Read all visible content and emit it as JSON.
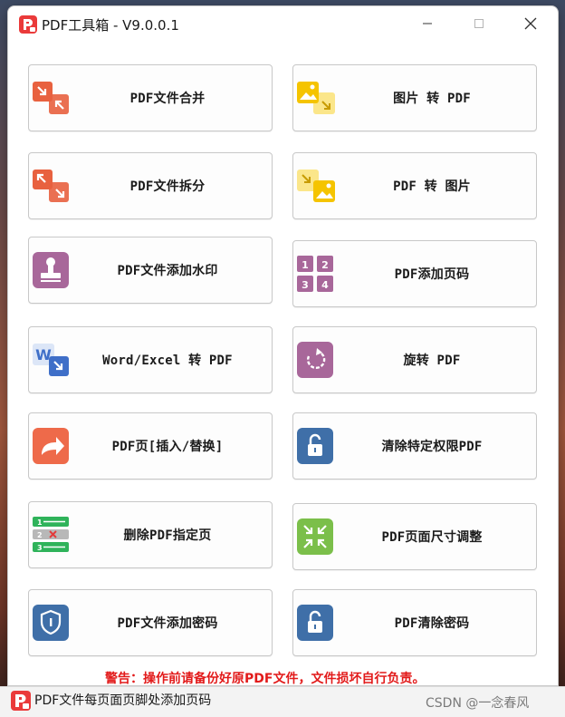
{
  "window": {
    "title": "PDF工具箱 - V9.0.0.1"
  },
  "tools": [
    {
      "label": "PDF文件合并",
      "icon": "merge-icon",
      "color": "#e8613f"
    },
    {
      "label": "图片 转 PDF",
      "icon": "image-to-pdf-icon",
      "color": "#f5c400"
    },
    {
      "label": "PDF文件拆分",
      "icon": "split-icon",
      "color": "#e8613f"
    },
    {
      "label": "PDF 转 图片",
      "icon": "pdf-to-image-icon",
      "color": "#f5c400"
    },
    {
      "label": "PDF文件添加水印",
      "icon": "stamp-icon",
      "color": "#a8679a"
    },
    {
      "label": "PDF添加页码",
      "icon": "page-number-icon",
      "color": "#a8679a"
    },
    {
      "label": "Word/Excel 转 PDF",
      "icon": "word-to-pdf-icon",
      "color": "#3f6fc8"
    },
    {
      "label": "旋转 PDF",
      "icon": "rotate-icon",
      "color": "#a8679a"
    },
    {
      "label": "PDF页[插入/替换]",
      "icon": "share-arrow-icon",
      "color": "#ee6a4a"
    },
    {
      "label": "清除特定权限PDF",
      "icon": "unlock-icon",
      "color": "#3f6fa8"
    },
    {
      "label": "删除PDF指定页",
      "icon": "delete-page-icon",
      "color": "#2fb35a"
    },
    {
      "label": "PDF页面尺寸调整",
      "icon": "resize-icon",
      "color": "#7bbf4a"
    },
    {
      "label": "PDF文件添加密码",
      "icon": "shield-icon",
      "color": "#3f6fa8"
    },
    {
      "label": "PDF清除密码",
      "icon": "unlock-icon",
      "color": "#3f6fa8"
    }
  ],
  "warning": "警告：操作前请备份好原PDF文件，文件损坏自行负责。",
  "taskbar": {
    "title": "PDF文件每页面页脚处添加页码",
    "watermark": "CSDN @一念春风"
  }
}
